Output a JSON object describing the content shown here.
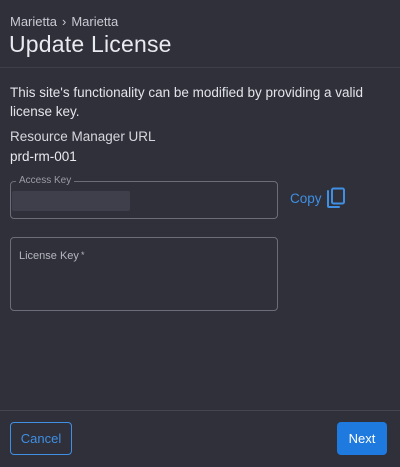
{
  "breadcrumb": {
    "items": [
      "Marietta",
      "Marietta"
    ],
    "separator": "›"
  },
  "page": {
    "title": "Update License",
    "description": "This site's functionality can be modified by providing a valid license key."
  },
  "resource_manager": {
    "label": "Resource Manager URL",
    "value": "prd-rm-001"
  },
  "access_key": {
    "label": "Access Key",
    "copy_label": "Copy",
    "copy_icon": "copy-icon"
  },
  "license_key": {
    "label": "License Key",
    "required_marker": "*",
    "value": ""
  },
  "footer": {
    "cancel_label": "Cancel",
    "next_label": "Next"
  },
  "colors": {
    "background": "#2f3039",
    "accent": "#3f8fe4",
    "primary_button": "#1f7ae0",
    "field_border": "#6c6d78"
  }
}
